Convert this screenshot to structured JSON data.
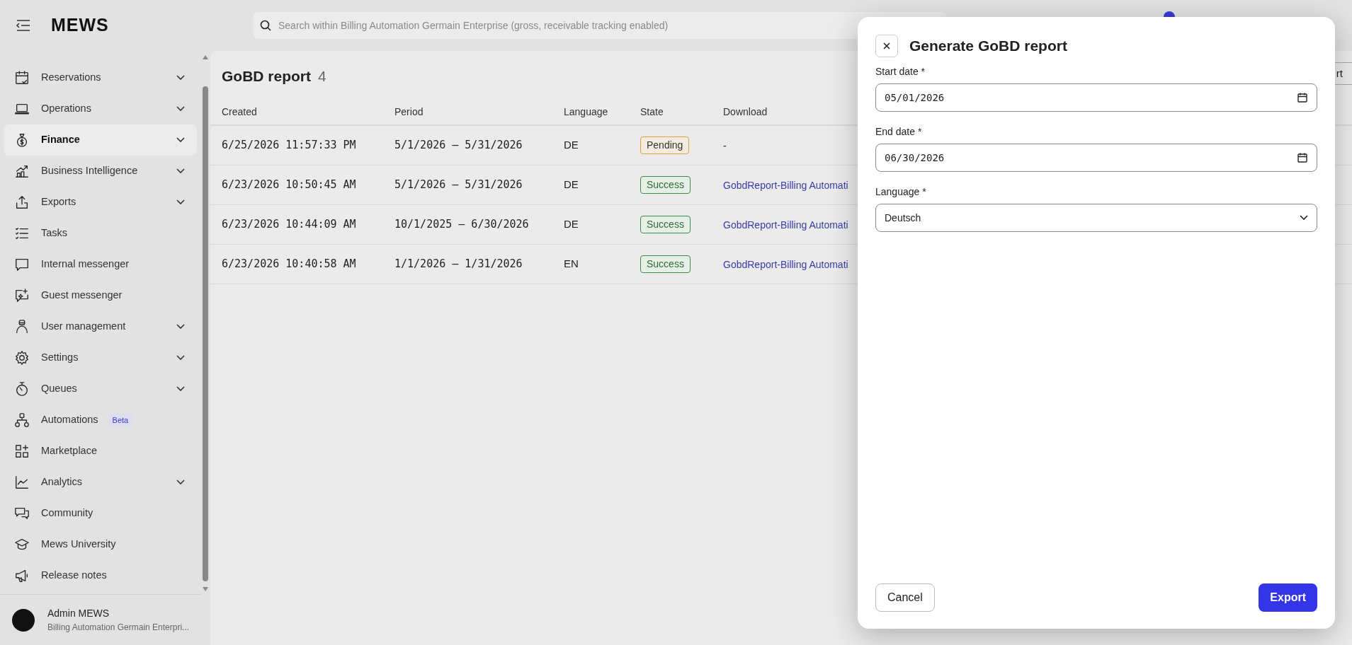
{
  "app": {
    "logo": "MEWS"
  },
  "search": {
    "placeholder": "Search within Billing Automation Germain Enterprise (gross, receivable tracking enabled)"
  },
  "sidebar": {
    "items": [
      {
        "label": "Reservations",
        "expandable": true,
        "selected": false
      },
      {
        "label": "Operations",
        "expandable": true,
        "selected": false
      },
      {
        "label": "Finance",
        "expandable": true,
        "selected": true
      },
      {
        "label": "Business Intelligence",
        "expandable": true,
        "selected": false
      },
      {
        "label": "Exports",
        "expandable": true,
        "selected": false
      },
      {
        "label": "Tasks",
        "expandable": false,
        "selected": false
      },
      {
        "label": "Internal messenger",
        "expandable": false,
        "selected": false
      },
      {
        "label": "Guest messenger",
        "expandable": false,
        "selected": false
      },
      {
        "label": "User management",
        "expandable": true,
        "selected": false
      },
      {
        "label": "Settings",
        "expandable": true,
        "selected": false
      },
      {
        "label": "Queues",
        "expandable": true,
        "selected": false
      },
      {
        "label": "Automations",
        "expandable": false,
        "selected": false,
        "badge": "Beta"
      },
      {
        "label": "Marketplace",
        "expandable": false,
        "selected": false
      },
      {
        "label": "Analytics",
        "expandable": true,
        "selected": false
      },
      {
        "label": "Community",
        "expandable": false,
        "selected": false
      },
      {
        "label": "Mews University",
        "expandable": false,
        "selected": false
      },
      {
        "label": "Release notes",
        "expandable": false,
        "selected": false
      }
    ],
    "user": {
      "name": "Admin MEWS",
      "property": "Billing Automation Germain Enterpri..."
    }
  },
  "page": {
    "title": "GoBD report",
    "count": "4",
    "partial_button": "rt"
  },
  "table": {
    "columns": [
      "Created",
      "Period",
      "Language",
      "State",
      "Download"
    ],
    "rows": [
      {
        "created": "6/25/2026 11:57:33 PM",
        "period": "5/1/2026 – 5/31/2026",
        "language": "DE",
        "state": {
          "label": "Pending",
          "kind": "pending"
        },
        "download": {
          "text": "-",
          "kind": "none"
        }
      },
      {
        "created": "6/23/2026 10:50:45 AM",
        "period": "5/1/2026 – 5/31/2026",
        "language": "DE",
        "state": {
          "label": "Success",
          "kind": "success"
        },
        "download": {
          "text": "GobdReport-Billing Automati",
          "kind": "link"
        }
      },
      {
        "created": "6/23/2026 10:44:09 AM",
        "period": "10/1/2025 – 6/30/2026",
        "language": "DE",
        "state": {
          "label": "Success",
          "kind": "success"
        },
        "download": {
          "text": "GobdReport-Billing Automati",
          "kind": "link"
        }
      },
      {
        "created": "6/23/2026 10:40:58 AM",
        "period": "1/1/2026 – 1/31/2026",
        "language": "EN",
        "state": {
          "label": "Success",
          "kind": "success"
        },
        "download": {
          "text": "GobdReport-Billing Automati",
          "kind": "link"
        }
      }
    ]
  },
  "dialog": {
    "title": "Generate GoBD report",
    "fields": [
      {
        "label": "Start date *",
        "value": "05/01/2026",
        "kind": "date"
      },
      {
        "label": "End date *",
        "value": "06/30/2026",
        "kind": "date"
      },
      {
        "label": "Language *",
        "value": "Deutsch",
        "kind": "select"
      }
    ],
    "buttons": [
      {
        "label": "Cancel",
        "kind": "secondary"
      },
      {
        "label": "Export",
        "kind": "primary"
      }
    ]
  }
}
